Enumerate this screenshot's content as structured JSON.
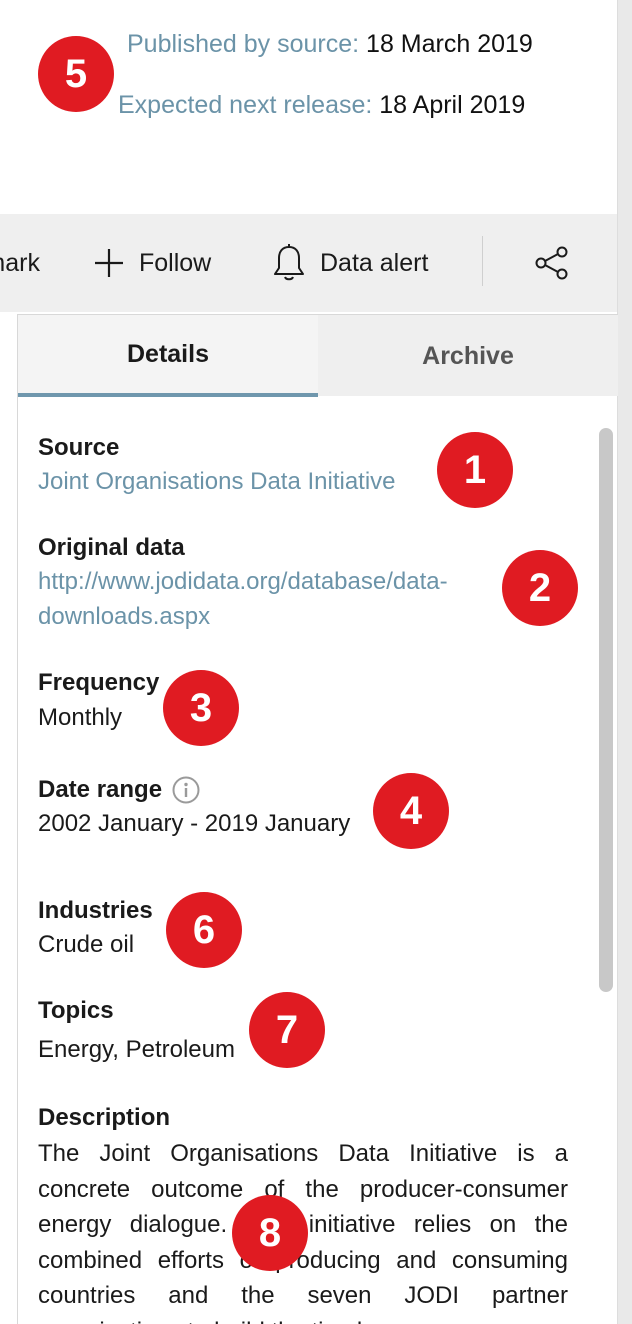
{
  "publication": {
    "published_label": "Published by source:",
    "published_value": "18 March 2019",
    "next_label": "Expected next release:",
    "next_value": "18 April 2019"
  },
  "actions": {
    "bookmark_label": "Bookmark",
    "follow_label": "Follow",
    "alert_label": "Data alert"
  },
  "tabs": {
    "details": "Details",
    "archive": "Archive"
  },
  "details": {
    "source_label": "Source",
    "source_value": "Joint Organisations Data Initiative",
    "original_label": "Original data",
    "original_line1": "http://www.jodidata.org/database/data-",
    "original_line2": "downloads.aspx",
    "frequency_label": "Frequency",
    "frequency_value": "Monthly",
    "date_range_label": "Date range",
    "date_range_value": "2002 January - 2019 January",
    "industries_label": "Industries",
    "industries_value": "Crude oil",
    "topics_label": "Topics",
    "topics_value": "Energy, Petroleum",
    "description_label": "Description",
    "description_value": "The Joint Organisations Data Initiative is a concrete outcome of the producer-consumer energy dialogue. This initiative relies on the combined efforts of producing and consuming countries and the seven JODI partner organisations to build the timely"
  },
  "badges": {
    "b1": "1",
    "b2": "2",
    "b3": "3",
    "b4": "4",
    "b5": "5",
    "b6": "6",
    "b7": "7",
    "b8": "8"
  },
  "colors": {
    "link": "#6b93a8",
    "badge": "#e01b22",
    "tab_underline": "#6f97ad"
  }
}
